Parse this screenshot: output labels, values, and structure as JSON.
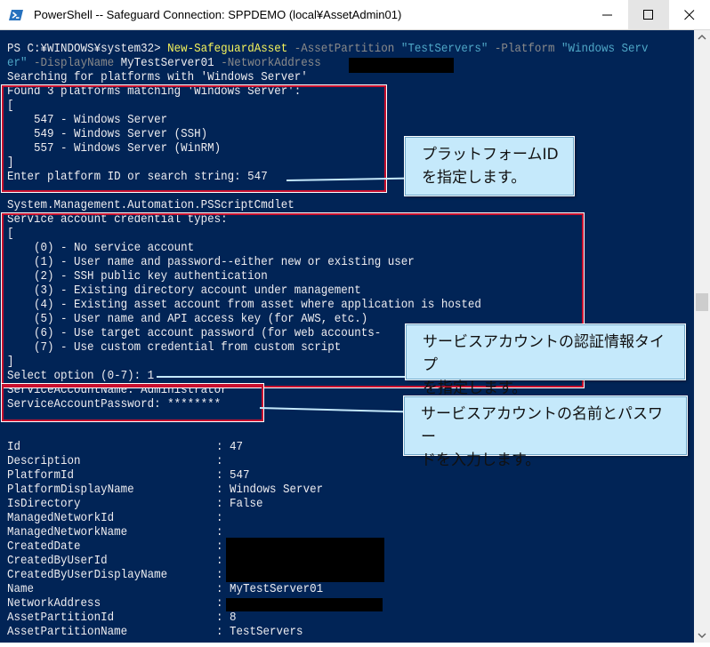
{
  "window": {
    "title": "PowerShell -- Safeguard Connection: SPPDEMO (local¥AssetAdmin01)"
  },
  "console": {
    "cmd_prompt": "PS C:¥WINDOWS¥system32> ",
    "cmd_name": "New-SafeguardAsset",
    "cmd_p1": " -AssetPartition ",
    "cmd_v1": "\"TestServers\"",
    "cmd_p2": " -Platform ",
    "cmd_v2a": "\"Windows Serv",
    "cmd_v2b": "er\"",
    "cmd_p3": " -DisplayName ",
    "cmd_v3": "MyTestServer01",
    "cmd_p4": " -NetworkAddress",
    "searching": "Searching for platforms with 'Windows Server'",
    "found": "Found 3 platforms matching 'Windows Server':",
    "open_bracket": "[",
    "close_bracket": "]",
    "platforms": [
      "    547 - Windows Server",
      "    549 - Windows Server (SSH)",
      "    557 - Windows Server (WinRM)"
    ],
    "enter_platform": "Enter platform ID or search string: 547",
    "cmdlet_type": "System.Management.Automation.PSScriptCmdlet",
    "cred_types_header": "Service account credential types:",
    "cred_options": [
      "    (0) - No service account",
      "    (1) - User name and password--either new or existing user",
      "    (2) - SSH public key authentication",
      "    (3) - Existing directory account under management",
      "    (4) - Existing asset account from asset where application is hosted",
      "    (5) - User name and API access key (for AWS, etc.)",
      "    (6) - Use target account password (for web accounts-",
      "    (7) - Use custom credential from custom script"
    ],
    "select_option": "Select option (0-7): 1",
    "svc_name": "ServiceAccountName: Administrator",
    "svc_password": "ServiceAccountPassword: ********",
    "properties": [
      {
        "key": "Id",
        "value": ": 47"
      },
      {
        "key": "Description",
        "value": ":"
      },
      {
        "key": "PlatformId",
        "value": ": 547"
      },
      {
        "key": "PlatformDisplayName",
        "value": ": Windows Server"
      },
      {
        "key": "IsDirectory",
        "value": ": False"
      },
      {
        "key": "ManagedNetworkId",
        "value": ":"
      },
      {
        "key": "ManagedNetworkName",
        "value": ":"
      },
      {
        "key": "CreatedDate",
        "value": ":"
      },
      {
        "key": "CreatedByUserId",
        "value": ":"
      },
      {
        "key": "CreatedByUserDisplayName",
        "value": ":"
      },
      {
        "key": "Name",
        "value": ": MyTestServer01"
      },
      {
        "key": "NetworkAddress",
        "value": ":"
      },
      {
        "key": "AssetPartitionId",
        "value": ": 8"
      },
      {
        "key": "AssetPartitionName",
        "value": ": TestServers"
      }
    ]
  },
  "callouts": {
    "platform_id": [
      "プラットフォームID",
      "を指定します。"
    ],
    "credential_type": [
      "サービスアカウントの認証情報タイプ",
      "を指定します。"
    ],
    "account_name": [
      "サービスアカウントの名前とパスワー",
      "ドを入力します。"
    ]
  },
  "colors": {
    "console_bg": "#012456",
    "console_text": "#eeedf0",
    "command_yellow": "#f5f35b",
    "parameter_gray": "#8a8a8a",
    "string_blue": "#4fa7c7",
    "highlight_red": "#c8102e",
    "callout_bg": "#c5e9fb"
  },
  "icons": {
    "app": "powershell-icon",
    "minimize": "minimize-icon",
    "maximize": "maximize-icon",
    "close": "close-icon"
  }
}
